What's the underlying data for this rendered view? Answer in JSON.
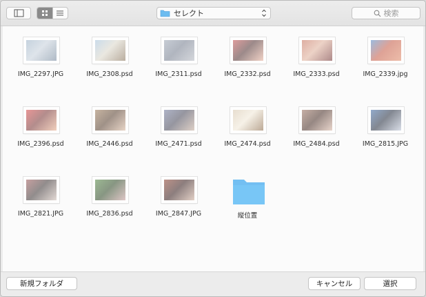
{
  "toolbar": {
    "location_label": "セレクト",
    "search_placeholder": "検索"
  },
  "items": [
    {
      "name": "IMG_2297.JPG",
      "kind": "image",
      "palette": [
        "#9eb4c8",
        "#7a8ca0",
        "#c8d2dc"
      ]
    },
    {
      "name": "IMG_2308.psd",
      "kind": "image",
      "palette": [
        "#a8c4dc",
        "#8c7860",
        "#dcd8cc"
      ]
    },
    {
      "name": "IMG_2311.psd",
      "kind": "image",
      "palette": [
        "#a0aab8",
        "#b8bcc4",
        "#7c8494"
      ]
    },
    {
      "name": "IMG_2332.psd",
      "kind": "image",
      "palette": [
        "#c85a5a",
        "#e8b4a0",
        "#5a3c3c"
      ]
    },
    {
      "name": "IMG_2333.psd",
      "kind": "image",
      "palette": [
        "#c87864",
        "#783c3c",
        "#e0b4a0"
      ]
    },
    {
      "name": "IMG_2339.jpg",
      "kind": "image",
      "palette": [
        "#5a8cc8",
        "#e09070",
        "#c86450"
      ]
    },
    {
      "name": "IMG_2396.psd",
      "kind": "image",
      "palette": [
        "#d85050",
        "#e8b090",
        "#804040"
      ]
    },
    {
      "name": "IMG_2446.psd",
      "kind": "image",
      "palette": [
        "#a08060",
        "#d8b8a0",
        "#604838"
      ]
    },
    {
      "name": "IMG_2471.psd",
      "kind": "image",
      "palette": [
        "#7880a0",
        "#c8b0a0",
        "#505060"
      ]
    },
    {
      "name": "IMG_2474.psd",
      "kind": "image",
      "palette": [
        "#d8c8b0",
        "#907050",
        "#f0e8d8"
      ]
    },
    {
      "name": "IMG_2484.psd",
      "kind": "image",
      "palette": [
        "#a07868",
        "#d8b8a8",
        "#503830"
      ]
    },
    {
      "name": "IMG_2815.JPG",
      "kind": "image",
      "palette": [
        "#4870a8",
        "#c0c8d8",
        "#303848"
      ]
    },
    {
      "name": "IMG_2821.JPG",
      "kind": "image",
      "palette": [
        "#a06060",
        "#d0c0b8",
        "#484040"
      ]
    },
    {
      "name": "IMG_2836.psd",
      "kind": "image",
      "palette": [
        "#5a8a4a",
        "#c8a0a0",
        "#385030"
      ]
    },
    {
      "name": "IMG_2847.JPG",
      "kind": "image",
      "palette": [
        "#904838",
        "#d0b0a0",
        "#402828"
      ]
    },
    {
      "name": "縦位置",
      "kind": "folder"
    }
  ],
  "buttons": {
    "new_folder": "新規フォルダ",
    "cancel": "キャンセル",
    "open": "選択"
  },
  "colors": {
    "folder_blue": "#5ab4f0",
    "active_segment": "#8a8a8a"
  }
}
